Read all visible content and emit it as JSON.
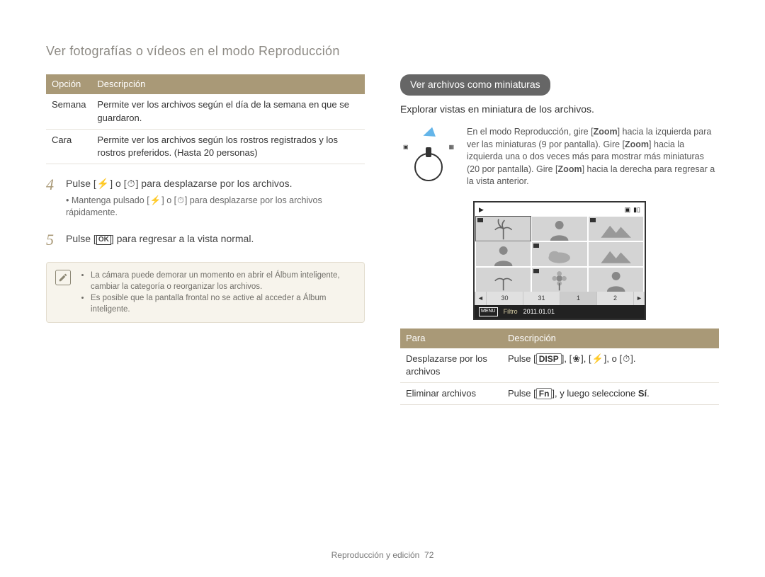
{
  "page_title": "Ver fotografías o vídeos en el modo Reproducción",
  "footer_section": "Reproducción y edición",
  "footer_page": "72",
  "table_left": {
    "headers": [
      "Opción",
      "Descripción"
    ],
    "rows": [
      {
        "option": "Semana",
        "desc": "Permite ver los archivos según el día de la semana en que se guardaron."
      },
      {
        "option": "Cara",
        "desc": "Permite ver los archivos según los rostros registrados y los rostros preferidos. (Hasta 20 personas)"
      }
    ]
  },
  "steps": {
    "s4_num": "4",
    "s4_pre": "Pulse [",
    "s4_mid": "] o [",
    "s4_post": "] para desplazarse por los archivos.",
    "s4_bullet_pre": "Mantenga pulsado [",
    "s4_bullet_mid": "] o [",
    "s4_bullet_post": "] para desplazarse por los archivos rápidamente.",
    "s5_num": "5",
    "s5_pre": "Pulse [",
    "s5_post": "] para regresar a la vista normal.",
    "ok_label": "OK"
  },
  "note": {
    "items": [
      "La cámara puede demorar un momento en abrir el Álbum inteligente, cambiar la categoría o reorganizar los archivos.",
      "Es posible que la pantalla frontal no se active al acceder a Álbum inteligente."
    ]
  },
  "right": {
    "pill": "Ver archivos como miniaturas",
    "sub": "Explorar vistas en miniatura de los archivos.",
    "zoom_a": "En el modo Reproducción, gire [",
    "zoom_b": "] hacia la izquierda para ver las miniaturas (9 por pantalla). Gire [",
    "zoom_c": "] hacia la izquierda una o dos veces más para mostrar más miniaturas (20 por pantalla). Gire [",
    "zoom_d": "] hacia la derecha para regresar a la vista anterior.",
    "zoom_label": "Zoom",
    "zoom_sym_left": "▣",
    "zoom_sym_right": "▦",
    "thumb_bar": [
      "◄",
      "30",
      "31",
      "1",
      "2",
      "►"
    ],
    "thumb_menu": "MENU",
    "thumb_filtro": "Filtro",
    "thumb_date": "2011.01.01"
  },
  "table_right": {
    "headers": [
      "Para",
      "Descripción"
    ],
    "rows": [
      {
        "para": "Desplazarse por los archivos",
        "desc_pre": "Pulse [",
        "desc_mid1": "], [",
        "desc_mid2": "], [",
        "desc_mid3": "], o [",
        "desc_post": "].",
        "disp": "DISP",
        "flower": "❀",
        "flash": "⚡",
        "timer": "⏱"
      },
      {
        "para": "Eliminar archivos",
        "desc_pre": "Pulse [",
        "desc_mid": "], y luego seleccione ",
        "fn": "Fn",
        "si": "Sí",
        "dot": "."
      }
    ]
  },
  "glyphs": {
    "flash": "⚡",
    "timer": "⏱"
  }
}
